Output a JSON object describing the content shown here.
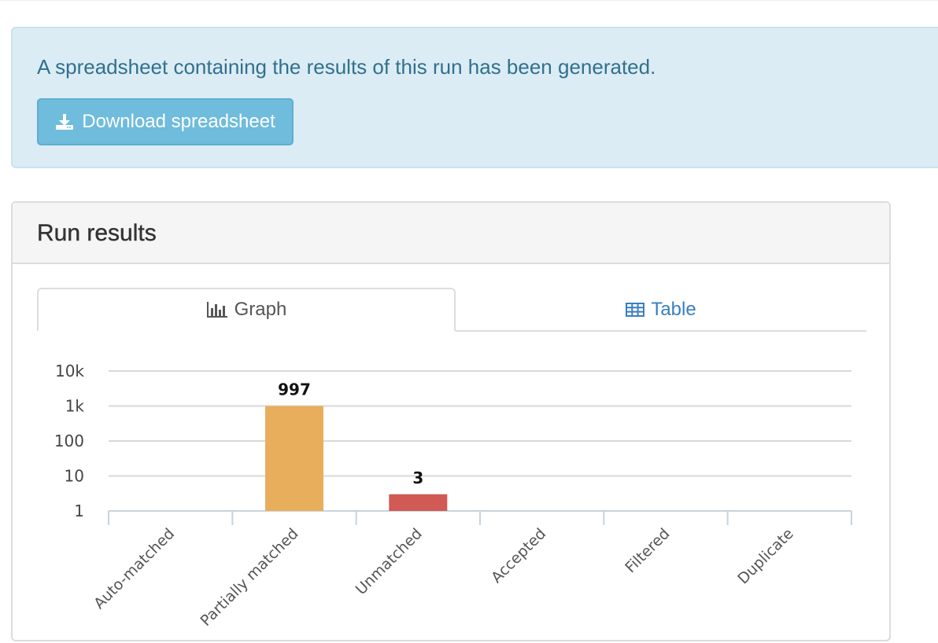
{
  "alert": {
    "message": "A spreadsheet containing the results of this run has been generated.",
    "download_label": "Download spreadsheet",
    "icon": "download-icon"
  },
  "panel": {
    "title": "Run results",
    "tabs": [
      {
        "label": "Graph",
        "icon": "bar-chart-icon",
        "active": true
      },
      {
        "label": "Table",
        "icon": "table-icon",
        "active": false
      }
    ]
  },
  "colors": {
    "alert_bg": "#dcecf4",
    "alert_text": "#31708f",
    "button_bg": "#6fbcdd",
    "link": "#3a7fc1",
    "bar_partial": "#e8ae5c",
    "bar_unmatched": "#d15a54"
  },
  "chart_data": {
    "type": "bar",
    "yscale": "log",
    "ylim": [
      1,
      10000
    ],
    "yticks": [
      {
        "value": 1,
        "label": "1"
      },
      {
        "value": 10,
        "label": "10"
      },
      {
        "value": 100,
        "label": "100"
      },
      {
        "value": 1000,
        "label": "1k"
      },
      {
        "value": 10000,
        "label": "10k"
      }
    ],
    "grid": true,
    "categories": [
      "Auto-matched",
      "Partially matched",
      "Unmatched",
      "Accepted",
      "Filtered",
      "Duplicate"
    ],
    "values": [
      0,
      997,
      3,
      0,
      0,
      0
    ],
    "data_labels": [
      "",
      "997",
      "3",
      "",
      "",
      ""
    ],
    "bar_colors": [
      "#e8ae5c",
      "#e8ae5c",
      "#d15a54",
      "#e8ae5c",
      "#e8ae5c",
      "#e8ae5c"
    ]
  }
}
